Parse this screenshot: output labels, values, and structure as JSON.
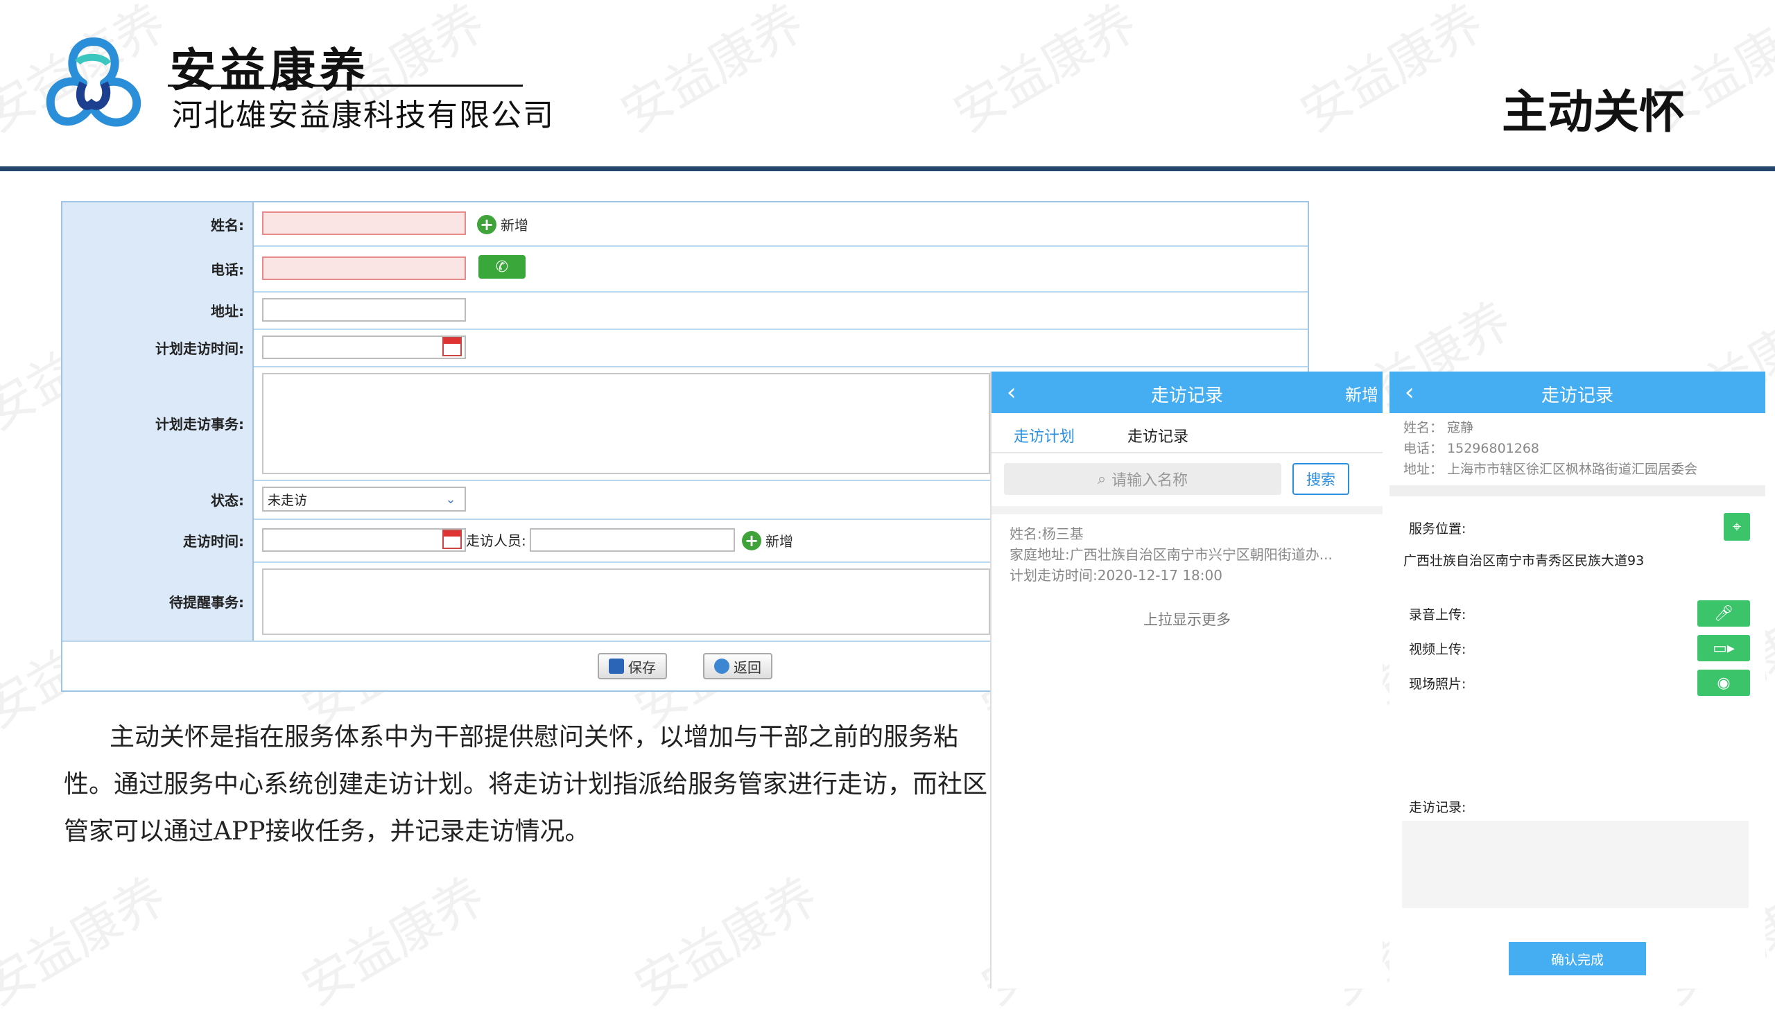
{
  "header": {
    "brand_title": "安益康养",
    "brand_subtitle": "河北雄安益康科技有限公司",
    "page_title": "主动关怀"
  },
  "colors": {
    "header_rule": "#24466d",
    "label_bg": "#dbe9f8",
    "accent_blue": "#45aef2",
    "green": "#3cc46b"
  },
  "form": {
    "name_label": "姓名:",
    "add_label": "新增",
    "phone_label": "电话:",
    "address_label": "地址:",
    "plan_time_label": "计划走访时间:",
    "plan_matter_label": "计划走访事务:",
    "status_label": "状态:",
    "status_value": "未走访",
    "visit_time_label": "走访时间:",
    "visitor_label": "走访人员:",
    "visitor_add_label": "新增",
    "remind_label": "待提醒事务:",
    "save_label": "保存",
    "back_label": "返回"
  },
  "description": "主动关怀是指在服务体系中为干部提供慰问关怀，以增加与干部之前的服务粘性。通过服务中心系统创建走访计划。将走访计划指派给服务管家进行走访，而社区管家可以通过APP接收任务，并记录走访情况。",
  "phone1": {
    "title": "走访记录",
    "action": "新增",
    "tab_plan": "走访计划",
    "tab_record": "走访记录",
    "search_placeholder": "请输入名称",
    "search_button": "搜索",
    "item_name": "姓名:杨三基",
    "item_address": "家庭地址:广西壮族自治区南宁市兴宁区朝阳街道办...",
    "item_time": "计划走访时间:2020-12-17 18:00",
    "more": "上拉显示更多"
  },
  "phone2": {
    "title": "走访记录",
    "name": "姓名：  寇静",
    "phone": "电话：  15296801268",
    "address": "地址：  上海市市辖区徐汇区枫林路街道汇园居委会",
    "location_label": "服务位置:",
    "location_value": "广西壮族自治区南宁市青秀区民族大道93",
    "audio_label": "录音上传:",
    "video_label": "视频上传:",
    "photo_label": "现场照片:",
    "record_label": "走访记录:",
    "confirm": "确认完成"
  },
  "watermark": "安益康养"
}
